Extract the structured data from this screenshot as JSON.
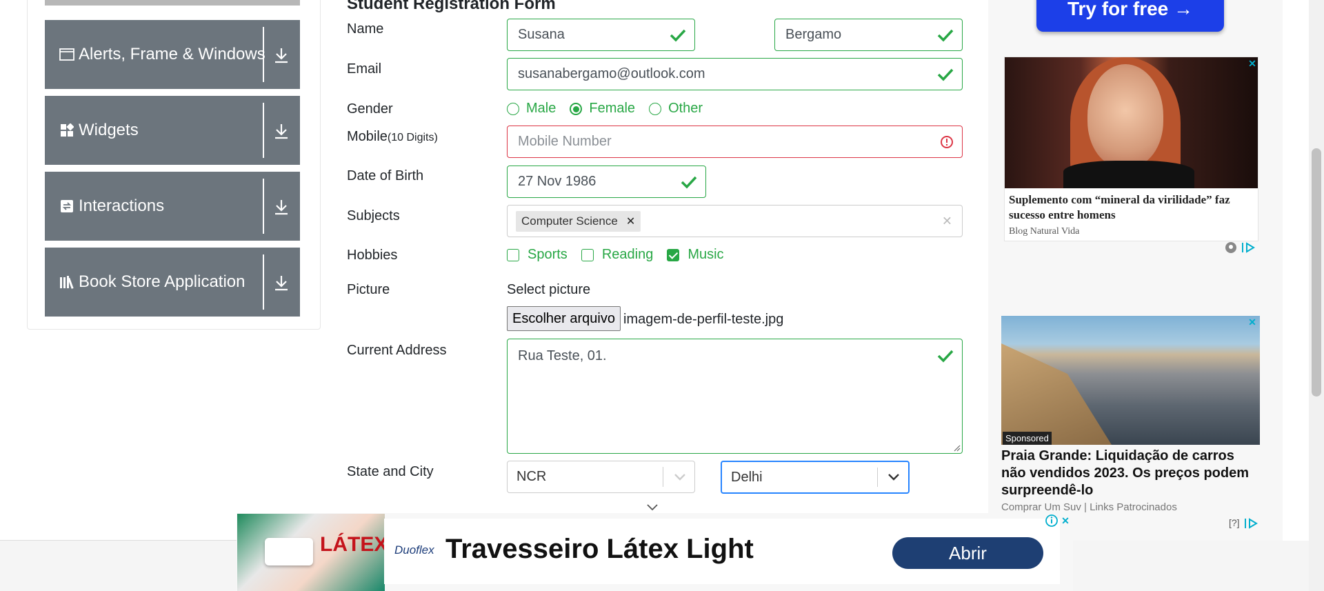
{
  "sidebar": {
    "groups": [
      {
        "label": "Alerts, Frame & Windows",
        "icon": "window-icon"
      },
      {
        "label": "Widgets",
        "icon": "widgets-icon"
      },
      {
        "label": "Interactions",
        "icon": "interactions-icon"
      },
      {
        "label": "Book Store Application",
        "icon": "books-icon"
      }
    ]
  },
  "form": {
    "title": "Student Registration Form",
    "labels": {
      "name": "Name",
      "email": "Email",
      "gender": "Gender",
      "mobile": "Mobile",
      "mobile_hint": "(10 Digits)",
      "dob": "Date of Birth",
      "subjects": "Subjects",
      "hobbies": "Hobbies",
      "picture": "Picture",
      "address": "Current Address",
      "state_city": "State and City"
    },
    "first_name": "Susana",
    "last_name": "Bergamo",
    "email": "susanabergamo@outlook.com",
    "gender_options": [
      "Male",
      "Female",
      "Other"
    ],
    "gender_selected": "Female",
    "mobile_placeholder": "Mobile Number",
    "dob": "27 Nov 1986",
    "subjects": [
      "Computer Science"
    ],
    "hobbies": [
      {
        "label": "Sports",
        "checked": false
      },
      {
        "label": "Reading",
        "checked": false
      },
      {
        "label": "Music",
        "checked": true
      }
    ],
    "picture_label": "Select picture",
    "file_button": "Escolher arquivo",
    "file_name": "imagem-de-perfil-teste.jpg",
    "address": "Rua Teste, 01.",
    "state": "NCR",
    "city": "Delhi"
  },
  "ads": {
    "try_button": "Try for free →",
    "card1": {
      "headline": "Suplemento com “mineral da virilidade” faz sucesso entre homens",
      "source": "Blog Natural Vida"
    },
    "card2": {
      "badge": "Sponsored",
      "headline": "Praia Grande: Liquidação de carros não vendidos 2023. Os preços podem surpreendê-lo",
      "source": "Comprar Um Suv | Links Patrocinados",
      "help": "[?]"
    },
    "banner": {
      "brand": "Duoflex",
      "title": "Travesseiro Látex Light",
      "button": "Abrir",
      "img_text": "LÁTEX"
    }
  },
  "colors": {
    "valid": "#28a745",
    "invalid": "#dc3545",
    "sidebar_group": "#6c757d",
    "focus": "#2684ff",
    "ad_button": "#1c3fe8",
    "banner_button": "#1e3f73"
  }
}
